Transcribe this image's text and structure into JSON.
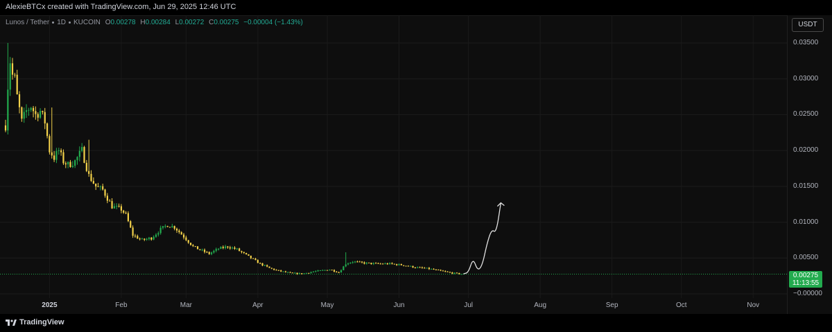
{
  "header": {
    "credit": "AlexieBTCx created with TradingView.com, Jun 29, 2025 12:46 UTC"
  },
  "legend": {
    "symbol": "Lunos / Tether",
    "interval": "1D",
    "exchange": "KUCOIN",
    "open_label": "O",
    "open": "0.00278",
    "high_label": "H",
    "high": "0.00284",
    "low_label": "L",
    "low": "0.00272",
    "close_label": "C",
    "close": "0.00275",
    "change": "−0.00004 (−1.43%)"
  },
  "currency_button": "USDT",
  "price_label": {
    "price": "0.00275",
    "countdown": "11:13:55"
  },
  "brand": {
    "name": "TradingView"
  },
  "colors": {
    "up": "#22ab4e",
    "down": "#f2d14a",
    "accent": "#22ab4e",
    "background": "#0e0e0e"
  },
  "chart_data": {
    "type": "candlestick",
    "title": "Lunos / Tether · 1D · KUCOIN",
    "y_axis": {
      "ticks": [
        "0.03500",
        "0.03000",
        "0.02500",
        "0.02000",
        "0.01500",
        "0.01000",
        "0.00500",
        "−0.00000"
      ],
      "range": [
        0,
        0.0355
      ],
      "last_price": 0.00275
    },
    "x_axis": {
      "ticks": [
        {
          "label": "2025",
          "bold": true
        },
        {
          "label": "Feb"
        },
        {
          "label": "Mar"
        },
        {
          "label": "Apr"
        },
        {
          "label": "May"
        },
        {
          "label": "Jun"
        },
        {
          "label": "Jul"
        },
        {
          "label": "Aug"
        },
        {
          "label": "Sep"
        },
        {
          "label": "Oct"
        },
        {
          "label": "Nov"
        }
      ]
    },
    "price_path": [
      [
        "2024-12-13",
        0.0235
      ],
      [
        "2024-12-14",
        0.029
      ],
      [
        "2024-12-15",
        0.0325
      ],
      [
        "2024-12-16",
        0.0305
      ],
      [
        "2024-12-17",
        0.03
      ],
      [
        "2024-12-18",
        0.0275
      ],
      [
        "2024-12-20",
        0.024
      ],
      [
        "2024-12-22",
        0.0255
      ],
      [
        "2024-12-24",
        0.0262
      ],
      [
        "2024-12-26",
        0.025
      ],
      [
        "2024-12-28",
        0.0255
      ],
      [
        "2024-12-30",
        0.024
      ],
      [
        "2025-01-01",
        0.02
      ],
      [
        "2025-01-03",
        0.019
      ],
      [
        "2025-01-05",
        0.02
      ],
      [
        "2025-01-07",
        0.0185
      ],
      [
        "2025-01-09",
        0.018
      ],
      [
        "2025-01-12",
        0.0185
      ],
      [
        "2025-01-15",
        0.02
      ],
      [
        "2025-01-18",
        0.0165
      ],
      [
        "2025-01-21",
        0.015
      ],
      [
        "2025-01-24",
        0.0145
      ],
      [
        "2025-01-28",
        0.0122
      ],
      [
        "2025-02-01",
        0.0118
      ],
      [
        "2025-02-03",
        0.011
      ],
      [
        "2025-02-06",
        0.0082
      ],
      [
        "2025-02-10",
        0.0075
      ],
      [
        "2025-02-14",
        0.0078
      ],
      [
        "2025-02-18",
        0.009
      ],
      [
        "2025-02-21",
        0.0096
      ],
      [
        "2025-02-24",
        0.0093
      ],
      [
        "2025-02-28",
        0.008
      ],
      [
        "2025-03-04",
        0.0066
      ],
      [
        "2025-03-08",
        0.006
      ],
      [
        "2025-03-11",
        0.0056
      ],
      [
        "2025-03-15",
        0.0063
      ],
      [
        "2025-03-19",
        0.0066
      ],
      [
        "2025-03-23",
        0.0062
      ],
      [
        "2025-03-28",
        0.0052
      ],
      [
        "2025-04-02",
        0.0042
      ],
      [
        "2025-04-06",
        0.0036
      ],
      [
        "2025-04-10",
        0.0032
      ],
      [
        "2025-04-15",
        0.0029
      ],
      [
        "2025-04-20",
        0.0028
      ],
      [
        "2025-04-25",
        0.0031
      ],
      [
        "2025-05-02",
        0.0034
      ],
      [
        "2025-05-06",
        0.003
      ],
      [
        "2025-05-09",
        0.0042
      ],
      [
        "2025-05-12",
        0.0045
      ],
      [
        "2025-05-17",
        0.0043
      ],
      [
        "2025-05-22",
        0.0042
      ],
      [
        "2025-05-28",
        0.0042
      ],
      [
        "2025-06-03",
        0.004
      ],
      [
        "2025-06-08",
        0.0037
      ],
      [
        "2025-06-14",
        0.0035
      ],
      [
        "2025-06-19",
        0.0032
      ],
      [
        "2025-06-24",
        0.0029
      ],
      [
        "2025-06-29",
        0.00275
      ]
    ],
    "spikes": [
      {
        "date": "2024-12-14",
        "high": 0.035
      },
      {
        "date": "2025-01-02",
        "high": 0.026
      },
      {
        "date": "2025-01-18",
        "high": 0.0215
      },
      {
        "date": "2025-05-09",
        "high": 0.0058
      }
    ],
    "projection_path": [
      [
        "2025-06-29",
        0.0028
      ],
      [
        "2025-07-01",
        0.003
      ],
      [
        "2025-07-03",
        0.005
      ],
      [
        "2025-07-05",
        0.0032
      ],
      [
        "2025-07-07",
        0.004
      ],
      [
        "2025-07-09",
        0.007
      ],
      [
        "2025-07-11",
        0.009
      ],
      [
        "2025-07-13",
        0.0085
      ],
      [
        "2025-07-15",
        0.0127
      ]
    ]
  }
}
